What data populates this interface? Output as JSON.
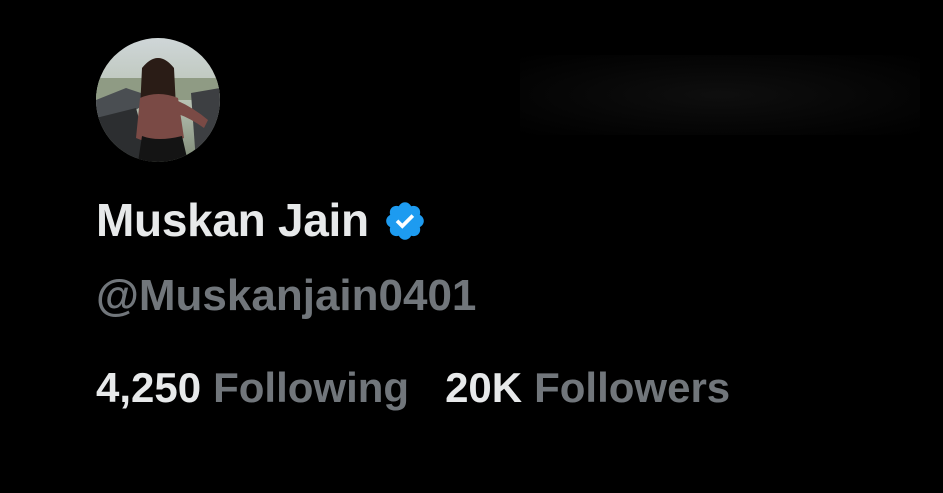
{
  "profile": {
    "display_name": "Muskan Jain",
    "handle": "@Muskanjain0401",
    "verified": true,
    "verified_badge_color": "#1d9bf0",
    "avatar_icon": "profile-photo"
  },
  "stats": {
    "following_count": "4,250",
    "following_label": "Following",
    "followers_count": "20K",
    "followers_label": "Followers"
  },
  "colors": {
    "background": "#000000",
    "primary_text": "#e7e9ea",
    "secondary_text": "#71767b"
  }
}
